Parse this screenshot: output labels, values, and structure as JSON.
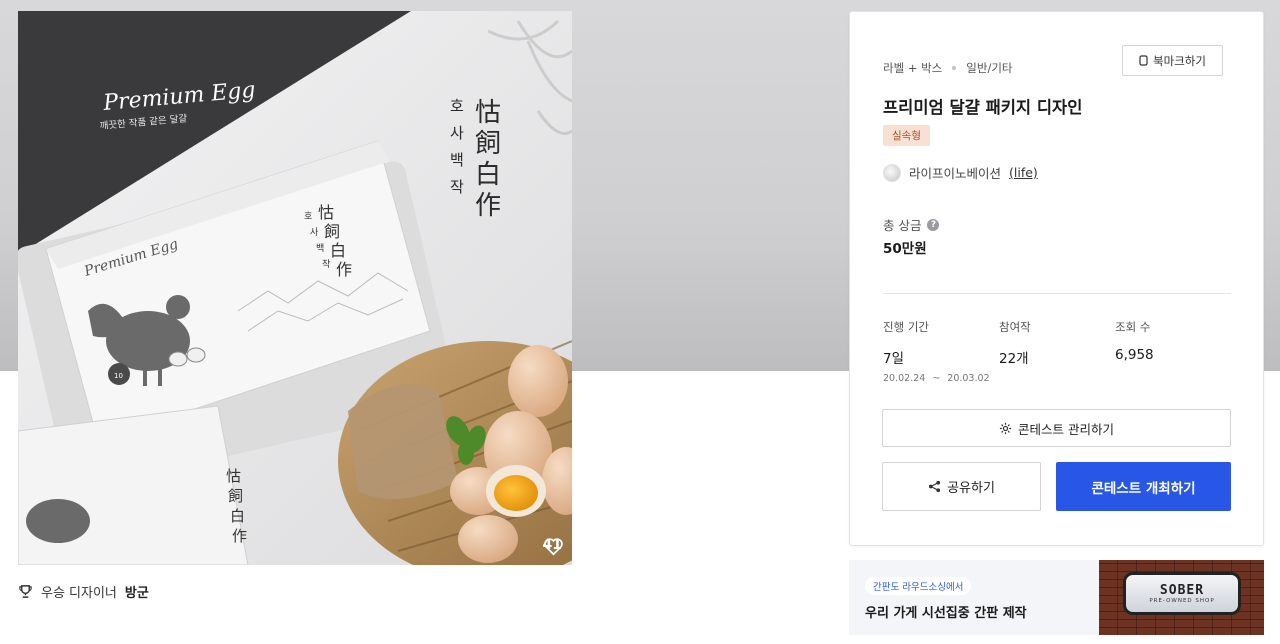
{
  "hero": {
    "brand_logo": "Premium Egg",
    "brand_tagline": "깨끗한 작품 같은 달걀",
    "vertical_hangul": [
      "호",
      "사",
      "백",
      "작"
    ],
    "vertical_hanja": [
      "怙",
      "飼",
      "白",
      "作"
    ],
    "box_count_badge": "10",
    "like_count": "41",
    "like_icon": "heart-icon"
  },
  "winner": {
    "icon": "trophy-icon",
    "label": "우승 디자이너",
    "name": "방군"
  },
  "contest": {
    "category": "라벨 + 박스",
    "subcategory": "일반/기타",
    "bookmark_label": "북마크하기",
    "title": "프리미엄 달걀 패키지 디자인",
    "type_badge": "실속형",
    "org_name": "라이프이노베이션",
    "org_handle": "(life)",
    "prize_label": "총 상금",
    "prize_help_icon": "?",
    "prize_value": "50만원",
    "stats": {
      "period_label": "진행 기간",
      "period_value": "7일",
      "period_start": "20.02.24",
      "period_sep": "~",
      "period_end": "20.03.02",
      "entries_label": "참여작",
      "entries_value": "22개",
      "views_label": "조회 수",
      "views_value": "6,958"
    },
    "manage_label": "콘테스트 관리하기",
    "share_label": "공유하기",
    "host_label": "콘테스트 개최하기",
    "colors": {
      "primary": "#2857e8",
      "badge_bg": "#f8e1d3",
      "badge_text": "#a3532a"
    }
  },
  "ad": {
    "pill": "간판도 라우드소싱에서",
    "headline": "우리 가게 시선집중 간판 제작",
    "sign_text": "SOBER",
    "sign_sub": "PRE-OWNED SHOP"
  }
}
